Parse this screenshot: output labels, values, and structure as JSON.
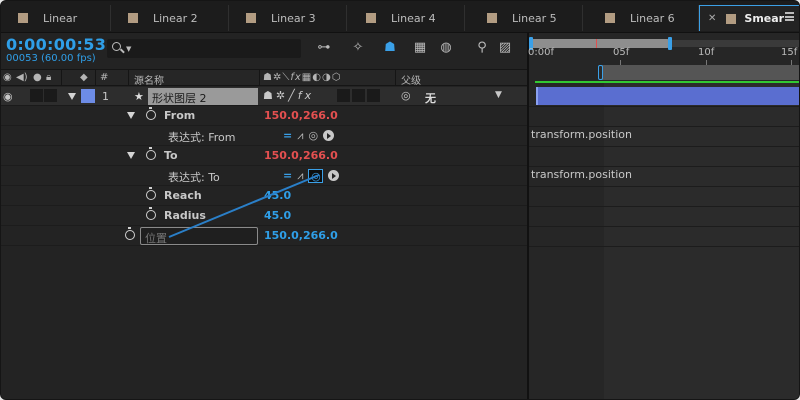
{
  "tabs": [
    {
      "label": "Linear",
      "active": false
    },
    {
      "label": "Linear 2",
      "active": false
    },
    {
      "label": "Linear 3",
      "active": false
    },
    {
      "label": "Linear 4",
      "active": false
    },
    {
      "label": "Linear 5",
      "active": false
    },
    {
      "label": "Linear 6",
      "active": false
    },
    {
      "label": "Smear",
      "active": true
    }
  ],
  "timecode": "0:00:00:53",
  "frames": "00053 (60.00 fps)",
  "search": {
    "value": "",
    "placeholder": ""
  },
  "columns": {
    "number": "#",
    "source_name": "源名称",
    "parent": "父级"
  },
  "layer": {
    "index": "1",
    "name": "形状图层 2",
    "parent": "无",
    "label_color": "#6d8ce6"
  },
  "properties": [
    {
      "name": "From",
      "value": "150.0,266.0"
    },
    {
      "expr_label": "表达式: From"
    },
    {
      "name": "To",
      "value": "150.0,266.0"
    },
    {
      "expr_label": "表达式: To"
    },
    {
      "name": "Reach",
      "value": "45.0"
    },
    {
      "name": "Radius",
      "value": "45.0"
    },
    {
      "name": "位置",
      "value": "150.0,266.0"
    }
  ],
  "timeline": {
    "ruler": [
      "0:00f",
      "05f",
      "10f",
      "15f"
    ],
    "expressions": [
      "transform.position",
      "transform.position"
    ]
  },
  "colors": {
    "accent": "#2f9fe8",
    "value_red": "#e55050",
    "work_area_green": "#32c832",
    "layer_bar": "#5a6ed0"
  }
}
